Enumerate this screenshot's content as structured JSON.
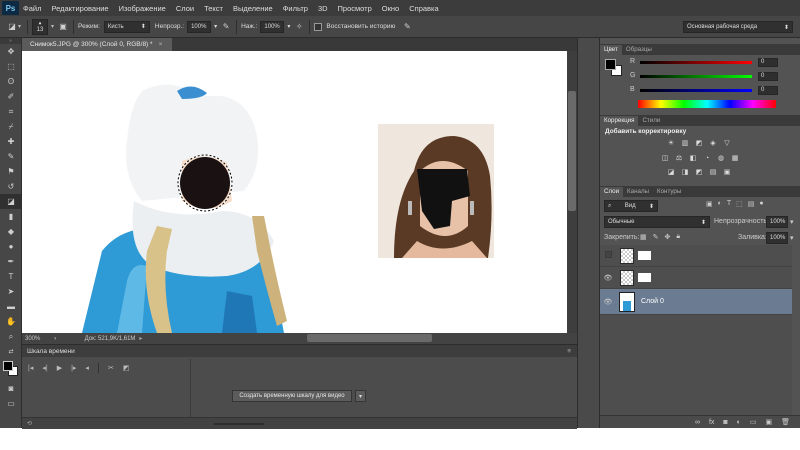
{
  "app": {
    "logo": "Ps"
  },
  "menu": [
    "Файл",
    "Редактирование",
    "Изображение",
    "Слои",
    "Текст",
    "Выделение",
    "Фильтр",
    "3D",
    "Просмотр",
    "Окно",
    "Справка"
  ],
  "options": {
    "brush_size": "13",
    "mode_label": "Режим:",
    "mode_value": "Кисть",
    "opacity_label": "Непрозр.:",
    "opacity_value": "100%",
    "pressure_label": "Наж.:",
    "pressure_value": "100%",
    "history_label": "Восстановить историю",
    "workspace": "Основная рабочая среда"
  },
  "document": {
    "tab_title": "Снимок5.JPG @ 300% (Слой 0, RGB/8) *",
    "zoom": "300%",
    "doc_info": "Док: 521,9K/1,61M"
  },
  "timeline": {
    "title": "Шкала времени",
    "create_button": "Создать временную шкалу для видео"
  },
  "color_panel": {
    "tabs": [
      "Цвет",
      "Образцы"
    ],
    "channels": [
      {
        "label": "R",
        "value": "0",
        "color": "#e23a2a"
      },
      {
        "label": "G",
        "value": "0",
        "color": "#2fbf3a"
      },
      {
        "label": "B",
        "value": "0",
        "color": "#2a3fe0"
      }
    ]
  },
  "adjustments_panel": {
    "tabs": [
      "Коррекция",
      "Стили"
    ],
    "subtitle": "Добавить корректировку",
    "row1": [
      "☀",
      "▥",
      "◩",
      "◈",
      "▽"
    ],
    "row2": [
      "◫",
      "⚖",
      "◧",
      "◔",
      "◍",
      "▦"
    ],
    "row3": [
      "◪",
      "◨",
      "◩",
      "▤",
      "▣"
    ]
  },
  "layers_panel": {
    "tabs": [
      "Слои",
      "Каналы",
      "Контуры"
    ],
    "filter_label": "Вид",
    "blend_mode": "Обычные",
    "opacity_label": "Непрозрачность:",
    "opacity_value": "100%",
    "lock_label": "Закрепить:",
    "fill_label": "Заливка:",
    "fill_value": "100%",
    "layers": [
      {
        "name": "",
        "visible": false,
        "selected": false
      },
      {
        "name": "",
        "visible": true,
        "selected": false
      },
      {
        "name": "Слой 0",
        "visible": true,
        "selected": true
      }
    ]
  },
  "colors": {
    "app_bg": "#535353",
    "selected_layer": "#6b7b92",
    "coat_blue": "#2e9ad6",
    "fur_white": "#f2f3f5"
  }
}
